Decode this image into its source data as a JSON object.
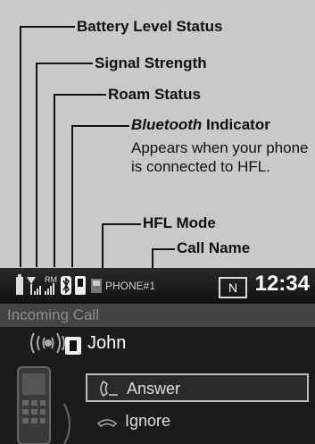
{
  "callouts": {
    "battery": "Battery Level Status",
    "signal": "Signal Strength",
    "roam": "Roam Status",
    "bluetooth_word": "Bluetooth",
    "indicator_word": " Indicator",
    "bluetooth_desc": "Appears when your phone is connected to HFL.",
    "hfl_mode": "HFL Mode",
    "call_name": "Call Name"
  },
  "screen": {
    "status": {
      "roam_mark": "RM",
      "phone_label": "PHONE#1",
      "mode_box": "N",
      "time": "12:34"
    },
    "title": "Incoming Call",
    "caller_name": "John",
    "buttons": {
      "answer": "Answer",
      "ignore": "Ignore"
    }
  }
}
